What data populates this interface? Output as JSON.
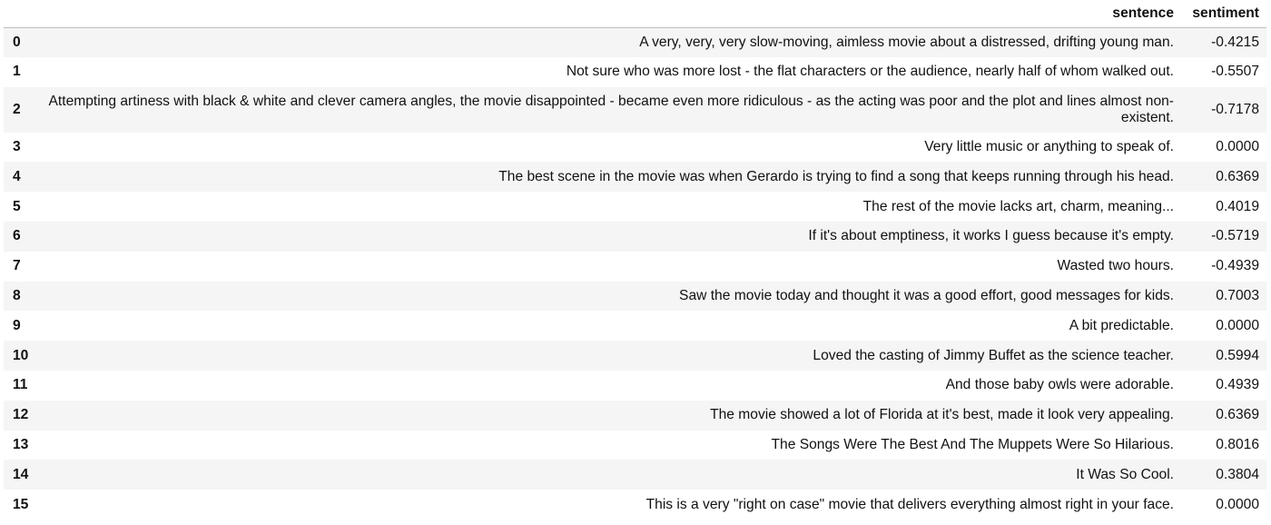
{
  "table": {
    "columns": {
      "index": "",
      "sentence": "sentence",
      "sentiment": "sentiment"
    },
    "rows": [
      {
        "index": "0",
        "sentence": "A very, very, very slow-moving, aimless movie about a distressed, drifting young man.",
        "sentiment": "-0.4215"
      },
      {
        "index": "1",
        "sentence": "Not sure who was more lost - the flat characters or the audience, nearly half of whom walked out.",
        "sentiment": "-0.5507"
      },
      {
        "index": "2",
        "sentence": "Attempting artiness with black & white and clever camera angles, the movie disappointed - became even more ridiculous - as the acting was poor and the plot and lines almost non-existent.",
        "sentiment": "-0.7178"
      },
      {
        "index": "3",
        "sentence": "Very little music or anything to speak of.",
        "sentiment": "0.0000"
      },
      {
        "index": "4",
        "sentence": "The best scene in the movie was when Gerardo is trying to find a song that keeps running through his head.",
        "sentiment": "0.6369"
      },
      {
        "index": "5",
        "sentence": "The rest of the movie lacks art, charm, meaning...",
        "sentiment": "0.4019"
      },
      {
        "index": "6",
        "sentence": "If it's about emptiness, it works I guess because it's empty.",
        "sentiment": "-0.5719"
      },
      {
        "index": "7",
        "sentence": "Wasted two hours.",
        "sentiment": "-0.4939"
      },
      {
        "index": "8",
        "sentence": "Saw the movie today and thought it was a good effort, good messages for kids.",
        "sentiment": "0.7003"
      },
      {
        "index": "9",
        "sentence": "A bit predictable.",
        "sentiment": "0.0000"
      },
      {
        "index": "10",
        "sentence": "Loved the casting of Jimmy Buffet as the science teacher.",
        "sentiment": "0.5994"
      },
      {
        "index": "11",
        "sentence": "And those baby owls were adorable.",
        "sentiment": "0.4939"
      },
      {
        "index": "12",
        "sentence": "The movie showed a lot of Florida at it's best, made it look very appealing.",
        "sentiment": "0.6369"
      },
      {
        "index": "13",
        "sentence": "The Songs Were The Best And The Muppets Were So Hilarious.",
        "sentiment": "0.8016"
      },
      {
        "index": "14",
        "sentence": "It Was So Cool.",
        "sentiment": "0.3804"
      },
      {
        "index": "15",
        "sentence": "This is a very \"right on case\" movie that delivers everything almost right in your face.",
        "sentiment": "0.0000"
      }
    ]
  }
}
